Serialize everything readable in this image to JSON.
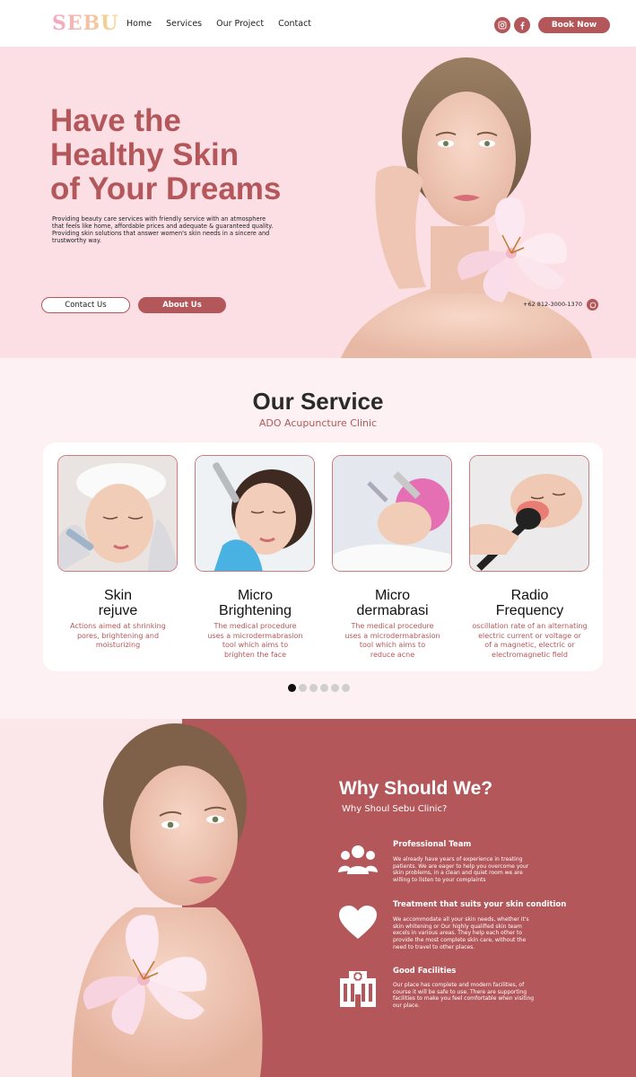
{
  "nav": {
    "logo": "SEBU",
    "links": [
      "Home",
      "Services",
      "Our Project",
      "Contact"
    ],
    "social_icons": [
      "instagram-icon",
      "facebook-icon"
    ],
    "book_label": "Book Now"
  },
  "hero": {
    "title": "Have the\nHealthy Skin\nof Your Dreams",
    "description": "Providing beauty care services with friendly service with an atmosphere that feels like home, affordable prices and adequate & guaranteed quality. Providing skin solutions that answer women's skin needs in a sincere and trustworthy way.",
    "contact_button": "Contact Us",
    "about_button": "About Us",
    "phone": "+62 812-3000-1370",
    "phone_icon": "whatsapp-icon"
  },
  "service": {
    "title": "Our Service",
    "subtitle": "ADO Acupuncture Clinic",
    "items": [
      {
        "name": "Skin\nrejuve",
        "desc": "Actions aimed at shrinking\npores, brightening and\nmoisturizing"
      },
      {
        "name": "Micro\nBrightening",
        "desc": "The medical procedure\nuses a microdermabrasion\ntool which aims to\nbrighten the face"
      },
      {
        "name": "Micro\ndermabrasi",
        "desc": "The medical procedure\nuses a microdermabrasion\ntool which aims to\nreduce acne"
      },
      {
        "name": "Radio\nFrequency",
        "desc": "oscillation rate of an alternating\nelectric current or voltage or\nof a magnetic, electric or\nelectromagnetic field"
      }
    ],
    "pagination_count": 6,
    "active_page": 1
  },
  "why": {
    "title": "Why Should We?",
    "subtitle": "Why Shoul Sebu Clinic?",
    "features": [
      {
        "icon": "team-icon",
        "title": "Professional Team",
        "desc": "We already have years of experience in treating patients. We are eager to help you overcome your skin problems, in a clean and quiet room we are willing to listen to your complaints"
      },
      {
        "icon": "heart-icon",
        "title": "Treatment that suits your skin condition",
        "desc": "We accommodate all your skin needs, whether it's skin whitening or Our highly qualified skin team excels in various areas. They help each other to provide the most complete skin care, without the need to travel to other places."
      },
      {
        "icon": "hospital-icon",
        "title": "Good Facilities",
        "desc": "Our place has complete and modern facilities, of course it will be safe to use. There are supporting facilities to make you feel comfortable when visiting our place."
      }
    ]
  },
  "colors": {
    "accent": "#b3575a",
    "hero_bg": "#fbdfe4",
    "service_bg": "#fdf1f3"
  }
}
